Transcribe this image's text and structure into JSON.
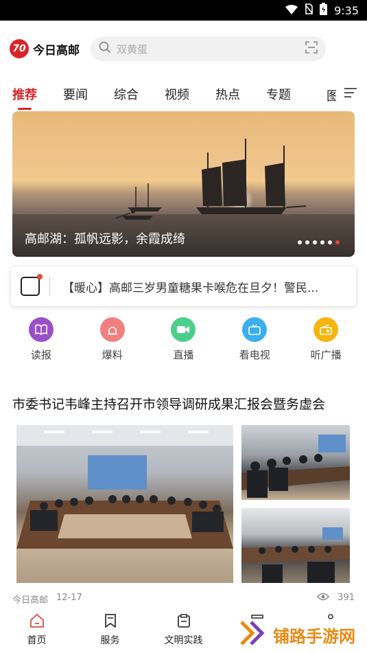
{
  "status": {
    "time": "9:35"
  },
  "header": {
    "logo_text": "今日高邮",
    "logo_mark": "70",
    "search_placeholder": "双黄蛋"
  },
  "tabs": [
    "推荐",
    "要闻",
    "综合",
    "视频",
    "热点",
    "专题"
  ],
  "tabs_clipped": "图",
  "banner": {
    "caption": "高邮湖：孤帆远影，余霞成绮",
    "slides": 6,
    "active_slide": 6
  },
  "notice": {
    "text": "【暖心】高邮三岁男童糖果卡喉危在旦夕！警民..."
  },
  "quick_links": [
    {
      "label": "读报",
      "color": "#9b4fc7",
      "icon": "book-icon",
      "glyph": "📖"
    },
    {
      "label": "爆料",
      "color": "#f08080",
      "icon": "siren-icon",
      "glyph": "🚨"
    },
    {
      "label": "直播",
      "color": "#4ccf8a",
      "icon": "video-camera-icon",
      "glyph": "▶"
    },
    {
      "label": "看电视",
      "color": "#3aaef0",
      "icon": "tv-icon",
      "glyph": "📺"
    },
    {
      "label": "听广播",
      "color": "#f6b40e",
      "icon": "radio-icon",
      "glyph": "📻"
    }
  ],
  "article": {
    "title": "市委书记韦峰主持召开市领导调研成果汇报会暨务虚会",
    "source": "今日高邮",
    "date": "12-17",
    "views": "391"
  },
  "bottom_nav": [
    {
      "label": "首页",
      "icon": "home-icon"
    },
    {
      "label": "服务",
      "icon": "bookmark-icon"
    },
    {
      "label": "文明实践",
      "icon": "clipboard-icon"
    }
  ],
  "watermark": {
    "text": "铺路手游网"
  }
}
